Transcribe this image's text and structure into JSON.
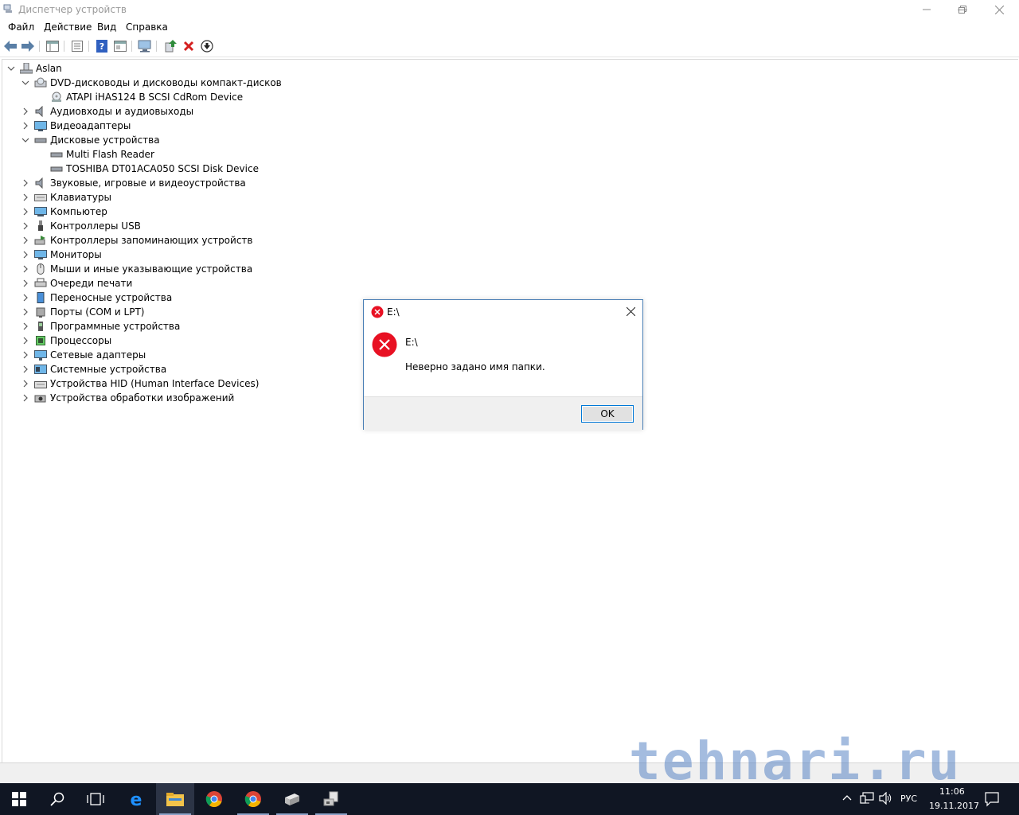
{
  "window": {
    "title": "Диспетчер устройств",
    "controls": {
      "minimize": "—",
      "restore": "❐",
      "close": "✕"
    }
  },
  "menu": [
    "Файл",
    "Действие",
    "Вид",
    "Справка"
  ],
  "toolbar": {
    "icons": [
      "back-arrow-icon",
      "forward-arrow-icon",
      "show-hide-tree-icon",
      "properties-icon",
      "help-icon",
      "view-icon",
      "scan-hardware-icon",
      "update-driver-icon",
      "uninstall-icon",
      "disable-device-icon"
    ],
    "colors": {
      "back_forward": "#5a7fa6",
      "uninstall": "#d42020",
      "help": "#3060c0",
      "update": "#2e8b3a"
    }
  },
  "tree": {
    "root": "Aslan",
    "items": [
      {
        "label": "DVD-дисководы и дисководы компакт-дисков",
        "expanded": true,
        "icon": "dvd-drive-icon"
      },
      {
        "label": "ATAPI iHAS124   B SCSI CdRom Device",
        "child": true,
        "icon": "dvd-disc-icon"
      },
      {
        "label": "Аудиовходы и аудиовыходы",
        "expanded": false,
        "icon": "speaker-icon"
      },
      {
        "label": "Видеоадаптеры",
        "expanded": false,
        "icon": "display-adapter-icon"
      },
      {
        "label": "Дисковые устройства",
        "expanded": true,
        "icon": "disk-drive-icon"
      },
      {
        "label": "Multi Flash Reader",
        "child": true,
        "icon": "disk-icon"
      },
      {
        "label": "TOSHIBA DT01ACA050 SCSI Disk Device",
        "child": true,
        "icon": "disk-icon"
      },
      {
        "label": "Звуковые, игровые и видеоустройства",
        "expanded": false,
        "icon": "sound-icon"
      },
      {
        "label": "Клавиатуры",
        "expanded": false,
        "icon": "keyboard-icon"
      },
      {
        "label": "Компьютер",
        "expanded": false,
        "icon": "computer-icon"
      },
      {
        "label": "Контроллеры USB",
        "expanded": false,
        "icon": "usb-icon"
      },
      {
        "label": "Контроллеры запоминающих устройств",
        "expanded": false,
        "icon": "storage-controller-icon"
      },
      {
        "label": "Мониторы",
        "expanded": false,
        "icon": "monitor-icon"
      },
      {
        "label": "Мыши и иные указывающие устройства",
        "expanded": false,
        "icon": "mouse-icon"
      },
      {
        "label": "Очереди печати",
        "expanded": false,
        "icon": "printer-icon"
      },
      {
        "label": "Переносные устройства",
        "expanded": false,
        "icon": "portable-device-icon"
      },
      {
        "label": "Порты (COM и LPT)",
        "expanded": false,
        "icon": "port-icon"
      },
      {
        "label": "Программные устройства",
        "expanded": false,
        "icon": "software-device-icon"
      },
      {
        "label": "Процессоры",
        "expanded": false,
        "icon": "processor-icon"
      },
      {
        "label": "Сетевые адаптеры",
        "expanded": false,
        "icon": "network-adapter-icon"
      },
      {
        "label": "Системные устройства",
        "expanded": false,
        "icon": "system-device-icon"
      },
      {
        "label": "Устройства HID (Human Interface Devices)",
        "expanded": false,
        "icon": "hid-icon"
      },
      {
        "label": "Устройства обработки изображений",
        "expanded": false,
        "icon": "imaging-device-icon"
      }
    ]
  },
  "dialog": {
    "title": "E:\\",
    "heading": "E:\\",
    "message": "Неверно задано имя папки.",
    "ok": "OK",
    "close": "✕",
    "error_color": "#e81123"
  },
  "taskbar": {
    "apps": [
      "windows-start-icon",
      "search-icon",
      "task-view-icon",
      "edge-icon",
      "file-explorer-icon",
      "chrome-icon",
      "chrome-icon",
      "device-manager-icon",
      "device-manager-icon"
    ],
    "tray": {
      "language": "РУС",
      "time": "11:06",
      "date": "19.11.2017"
    }
  },
  "watermark": "tehnari.ru"
}
